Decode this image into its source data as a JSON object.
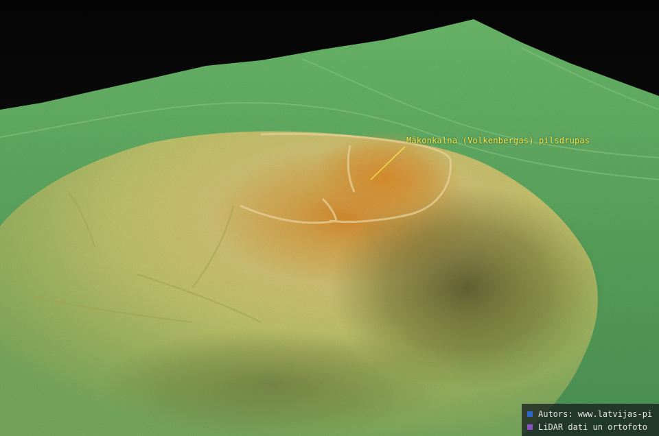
{
  "annotation": {
    "label": "Mākonkalna (Volkenbergas) pilsdrupas",
    "color": "#f3e64a"
  },
  "credits": [
    {
      "text": "Autors: www.latvijas-pi",
      "swatch_color": "#2d66c8"
    },
    {
      "text": "LiDAR dati un ortofoto",
      "swatch_color": "#8a4fc4"
    }
  ],
  "colors": {
    "sky": "#0b0b0b",
    "low_terrain": "#5ea860",
    "mid_terrain": "#c9c76a",
    "high_terrain": "#d2922e"
  }
}
